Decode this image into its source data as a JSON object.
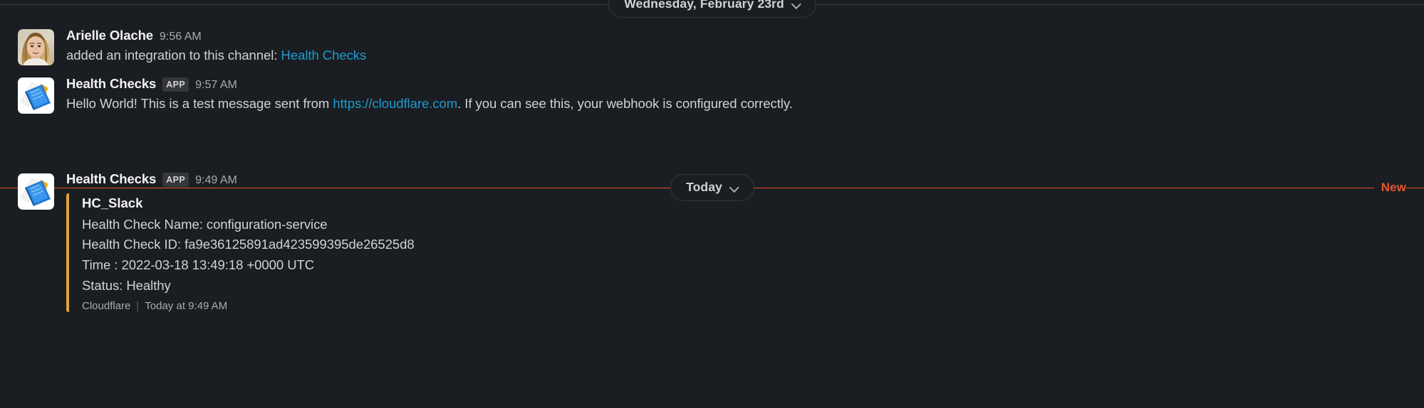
{
  "app": {
    "name": "Slack",
    "theme_bg": "#1A1D21",
    "link_color": "#1D9BD1",
    "unread_color": "#E8542F",
    "attachment_bar_color": "#E0A33B"
  },
  "dividers": [
    {
      "label": "Wednesday, February 23rd",
      "chevron_icon": "chevron-down-icon",
      "unread": false,
      "new_label": ""
    },
    {
      "label": "Today",
      "chevron_icon": "chevron-down-icon",
      "unread": true,
      "new_label": "New"
    }
  ],
  "messages": [
    {
      "sender": "Arielle Olache",
      "avatar_icon": "user-avatar",
      "is_app": false,
      "app_badge": "",
      "time": "9:56 AM",
      "text_before": "added an integration to this channel: ",
      "link_text": "Health Checks",
      "text_after": ""
    },
    {
      "sender": "Health Checks",
      "avatar_icon": "health-checks-app-icon",
      "is_app": true,
      "app_badge": "APP",
      "time": "9:57 AM",
      "text_before": "Hello World! This is a test message sent from ",
      "link_text": "https://cloudflare.com",
      "text_after": ". If you can see this, your webhook is configured correctly."
    },
    {
      "sender": "Health Checks",
      "avatar_icon": "health-checks-app-icon",
      "is_app": true,
      "app_badge": "APP",
      "time": "9:49 AM",
      "attachment": {
        "title": "HC_Slack",
        "lines": [
          "Health Check Name: configuration-service",
          "Health Check ID: fa9e36125891ad423599395de26525d8",
          "Time : 2022-03-18 13:49:18 +0000 UTC",
          "Status: Healthy"
        ],
        "footer_source": "Cloudflare",
        "footer_separator": "|",
        "footer_time": "Today at 9:49 AM"
      }
    }
  ]
}
